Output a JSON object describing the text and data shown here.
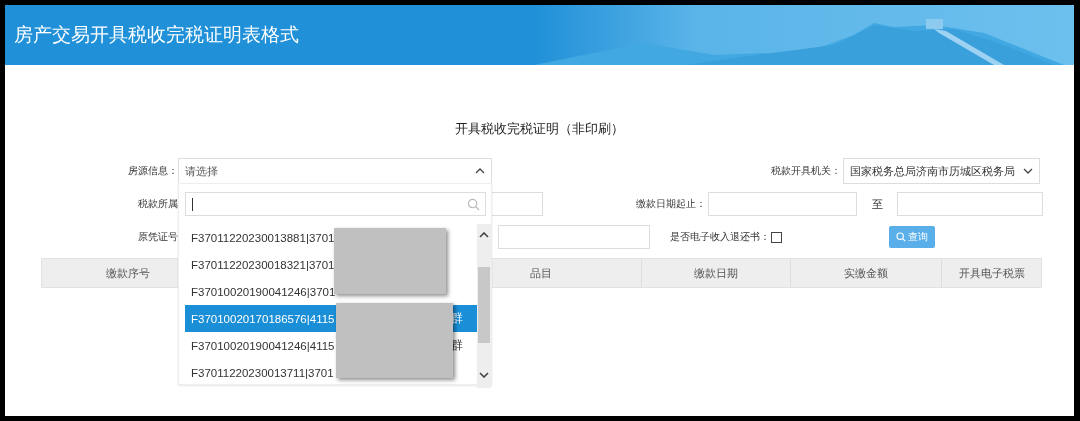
{
  "header": {
    "title": "房产交易开具税收完税证明表格式"
  },
  "form_title": "开具税收完税证明（非印刷）",
  "property_select": {
    "label": "房源信息：",
    "placeholder": "请选择",
    "expanded": true
  },
  "issuing_office": {
    "label": "税款开具机关：",
    "value": "国家税务总局济南市历城区税务局"
  },
  "tax_period": {
    "label": "税款所属"
  },
  "payment_date": {
    "label": "缴款日期起止：",
    "separator": "至"
  },
  "voucher_no": {
    "label": "原凭证号"
  },
  "refund_certificate": {
    "label": "是否电子收入退还书：",
    "checked": false
  },
  "query_button": {
    "label": "查询"
  },
  "table": {
    "columns": [
      "缴款序号",
      "品目",
      "缴款日期",
      "实缴金额",
      "开具电子税票"
    ]
  },
  "dropdown": {
    "items": [
      {
        "text": "F37011220230013881|3701",
        "selected": false
      },
      {
        "text": "F37011220230018321|3701",
        "selected": false
      },
      {
        "text": "F37010020190041246|3701",
        "selected": false
      },
      {
        "text": "F37010020170186576|4115",
        "tail": "群",
        "selected": true
      },
      {
        "text": "F37010020190041246|4115",
        "tail": "群",
        "selected": false
      },
      {
        "text": "F37011220230013711|3701",
        "selected": false
      }
    ]
  }
}
